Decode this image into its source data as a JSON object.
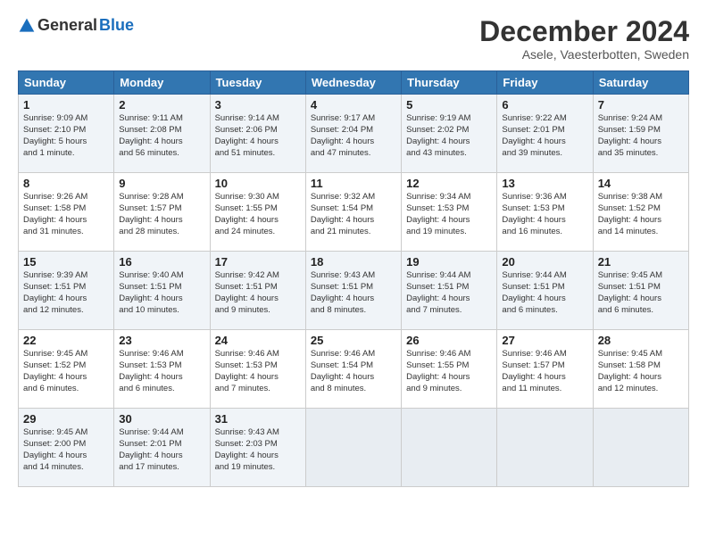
{
  "header": {
    "logo_general": "General",
    "logo_blue": "Blue",
    "month_title": "December 2024",
    "location": "Asele, Vaesterbotten, Sweden"
  },
  "days_of_week": [
    "Sunday",
    "Monday",
    "Tuesday",
    "Wednesday",
    "Thursday",
    "Friday",
    "Saturday"
  ],
  "weeks": [
    [
      {
        "day": "1",
        "lines": [
          "Sunrise: 9:09 AM",
          "Sunset: 2:10 PM",
          "Daylight: 5 hours",
          "and 1 minute."
        ]
      },
      {
        "day": "2",
        "lines": [
          "Sunrise: 9:11 AM",
          "Sunset: 2:08 PM",
          "Daylight: 4 hours",
          "and 56 minutes."
        ]
      },
      {
        "day": "3",
        "lines": [
          "Sunrise: 9:14 AM",
          "Sunset: 2:06 PM",
          "Daylight: 4 hours",
          "and 51 minutes."
        ]
      },
      {
        "day": "4",
        "lines": [
          "Sunrise: 9:17 AM",
          "Sunset: 2:04 PM",
          "Daylight: 4 hours",
          "and 47 minutes."
        ]
      },
      {
        "day": "5",
        "lines": [
          "Sunrise: 9:19 AM",
          "Sunset: 2:02 PM",
          "Daylight: 4 hours",
          "and 43 minutes."
        ]
      },
      {
        "day": "6",
        "lines": [
          "Sunrise: 9:22 AM",
          "Sunset: 2:01 PM",
          "Daylight: 4 hours",
          "and 39 minutes."
        ]
      },
      {
        "day": "7",
        "lines": [
          "Sunrise: 9:24 AM",
          "Sunset: 1:59 PM",
          "Daylight: 4 hours",
          "and 35 minutes."
        ]
      }
    ],
    [
      {
        "day": "8",
        "lines": [
          "Sunrise: 9:26 AM",
          "Sunset: 1:58 PM",
          "Daylight: 4 hours",
          "and 31 minutes."
        ]
      },
      {
        "day": "9",
        "lines": [
          "Sunrise: 9:28 AM",
          "Sunset: 1:57 PM",
          "Daylight: 4 hours",
          "and 28 minutes."
        ]
      },
      {
        "day": "10",
        "lines": [
          "Sunrise: 9:30 AM",
          "Sunset: 1:55 PM",
          "Daylight: 4 hours",
          "and 24 minutes."
        ]
      },
      {
        "day": "11",
        "lines": [
          "Sunrise: 9:32 AM",
          "Sunset: 1:54 PM",
          "Daylight: 4 hours",
          "and 21 minutes."
        ]
      },
      {
        "day": "12",
        "lines": [
          "Sunrise: 9:34 AM",
          "Sunset: 1:53 PM",
          "Daylight: 4 hours",
          "and 19 minutes."
        ]
      },
      {
        "day": "13",
        "lines": [
          "Sunrise: 9:36 AM",
          "Sunset: 1:53 PM",
          "Daylight: 4 hours",
          "and 16 minutes."
        ]
      },
      {
        "day": "14",
        "lines": [
          "Sunrise: 9:38 AM",
          "Sunset: 1:52 PM",
          "Daylight: 4 hours",
          "and 14 minutes."
        ]
      }
    ],
    [
      {
        "day": "15",
        "lines": [
          "Sunrise: 9:39 AM",
          "Sunset: 1:51 PM",
          "Daylight: 4 hours",
          "and 12 minutes."
        ]
      },
      {
        "day": "16",
        "lines": [
          "Sunrise: 9:40 AM",
          "Sunset: 1:51 PM",
          "Daylight: 4 hours",
          "and 10 minutes."
        ]
      },
      {
        "day": "17",
        "lines": [
          "Sunrise: 9:42 AM",
          "Sunset: 1:51 PM",
          "Daylight: 4 hours",
          "and 9 minutes."
        ]
      },
      {
        "day": "18",
        "lines": [
          "Sunrise: 9:43 AM",
          "Sunset: 1:51 PM",
          "Daylight: 4 hours",
          "and 8 minutes."
        ]
      },
      {
        "day": "19",
        "lines": [
          "Sunrise: 9:44 AM",
          "Sunset: 1:51 PM",
          "Daylight: 4 hours",
          "and 7 minutes."
        ]
      },
      {
        "day": "20",
        "lines": [
          "Sunrise: 9:44 AM",
          "Sunset: 1:51 PM",
          "Daylight: 4 hours",
          "and 6 minutes."
        ]
      },
      {
        "day": "21",
        "lines": [
          "Sunrise: 9:45 AM",
          "Sunset: 1:51 PM",
          "Daylight: 4 hours",
          "and 6 minutes."
        ]
      }
    ],
    [
      {
        "day": "22",
        "lines": [
          "Sunrise: 9:45 AM",
          "Sunset: 1:52 PM",
          "Daylight: 4 hours",
          "and 6 minutes."
        ]
      },
      {
        "day": "23",
        "lines": [
          "Sunrise: 9:46 AM",
          "Sunset: 1:53 PM",
          "Daylight: 4 hours",
          "and 6 minutes."
        ]
      },
      {
        "day": "24",
        "lines": [
          "Sunrise: 9:46 AM",
          "Sunset: 1:53 PM",
          "Daylight: 4 hours",
          "and 7 minutes."
        ]
      },
      {
        "day": "25",
        "lines": [
          "Sunrise: 9:46 AM",
          "Sunset: 1:54 PM",
          "Daylight: 4 hours",
          "and 8 minutes."
        ]
      },
      {
        "day": "26",
        "lines": [
          "Sunrise: 9:46 AM",
          "Sunset: 1:55 PM",
          "Daylight: 4 hours",
          "and 9 minutes."
        ]
      },
      {
        "day": "27",
        "lines": [
          "Sunrise: 9:46 AM",
          "Sunset: 1:57 PM",
          "Daylight: 4 hours",
          "and 11 minutes."
        ]
      },
      {
        "day": "28",
        "lines": [
          "Sunrise: 9:45 AM",
          "Sunset: 1:58 PM",
          "Daylight: 4 hours",
          "and 12 minutes."
        ]
      }
    ],
    [
      {
        "day": "29",
        "lines": [
          "Sunrise: 9:45 AM",
          "Sunset: 2:00 PM",
          "Daylight: 4 hours",
          "and 14 minutes."
        ]
      },
      {
        "day": "30",
        "lines": [
          "Sunrise: 9:44 AM",
          "Sunset: 2:01 PM",
          "Daylight: 4 hours",
          "and 17 minutes."
        ]
      },
      {
        "day": "31",
        "lines": [
          "Sunrise: 9:43 AM",
          "Sunset: 2:03 PM",
          "Daylight: 4 hours",
          "and 19 minutes."
        ]
      },
      {
        "day": "",
        "lines": []
      },
      {
        "day": "",
        "lines": []
      },
      {
        "day": "",
        "lines": []
      },
      {
        "day": "",
        "lines": []
      }
    ]
  ]
}
